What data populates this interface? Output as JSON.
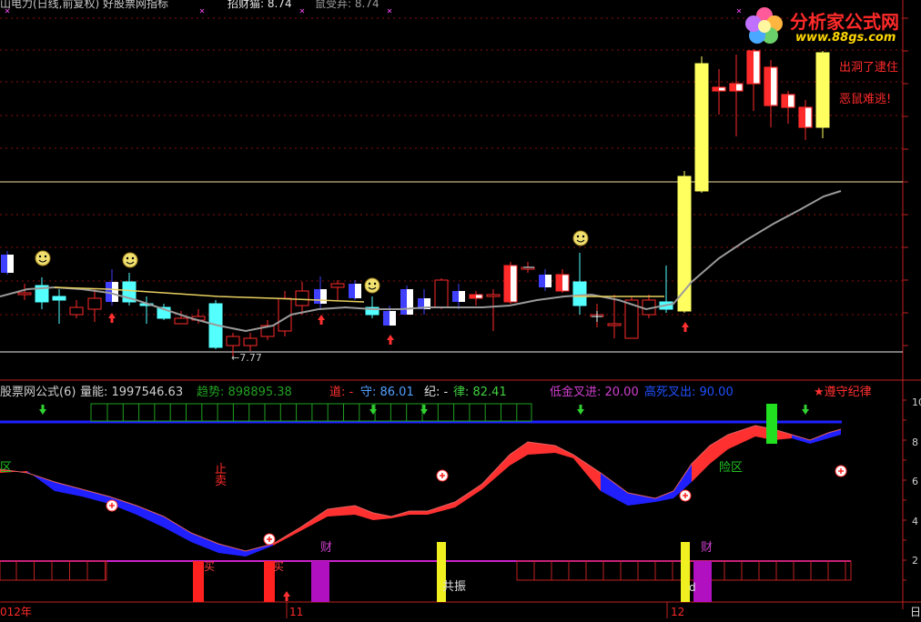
{
  "top_pane": {
    "title": "山电力(日线,前复权) 好股票网指标",
    "ind1": "招财猫: 8.74",
    "ind2": "鼠受弃: 8.74",
    "note1": "出洞了逮住",
    "note2": "恶鼠难逃!",
    "low_label": "←7.77"
  },
  "bottom_pane": {
    "name": "股票网公式(6)",
    "vol": "量能: 1997546.63",
    "trend": "趋势: 898895.38",
    "dao": "道: -",
    "shou": "守: 86.01",
    "ji": "纪: -",
    "lv": "律: 82.41",
    "golden": "低金叉进: 20.00",
    "dead": "高死叉出: 90.00",
    "star": "★遵守纪律",
    "zone_left": "区",
    "zone_right": "险区",
    "sell": "止卖",
    "cai1": "财",
    "cai2": "财",
    "gongzhen": "共振",
    "mai1": "买",
    "mai2": "买",
    "d": "d"
  },
  "axis": {
    "dates": [
      "012年",
      "11",
      "12"
    ],
    "right_ticks": [
      "10",
      "8",
      "6",
      "4",
      "2"
    ],
    "corner": "日"
  },
  "logo": {
    "cn": "分析家公式网",
    "url": "www.88gs.com"
  },
  "colors": {
    "up": "#ff2a2a",
    "down": "#4040ff",
    "cyan": "#54ffff",
    "yellow": "#ffff60",
    "ma": "#9a9a9a",
    "ma2": "#e8d060",
    "grid": "#8a1010",
    "band_blue": "#2020ff",
    "band_red": "#ff3030",
    "magenta": "#cc22cc"
  },
  "chart_data": {
    "type": "candlestick",
    "ohlc_approx_price": [
      {
        "o": 8.4,
        "h": 8.55,
        "l": 8.15,
        "c": 8.2
      },
      {
        "o": 8.05,
        "h": 8.1,
        "l": 7.9,
        "c": 7.95
      },
      {
        "o": 8.02,
        "h": 8.15,
        "l": 7.9,
        "c": 8.05
      }
    ],
    "price_labels": [
      "7.77"
    ],
    "ma_line": "gray",
    "lower_indicator_range": [
      0,
      10
    ]
  }
}
